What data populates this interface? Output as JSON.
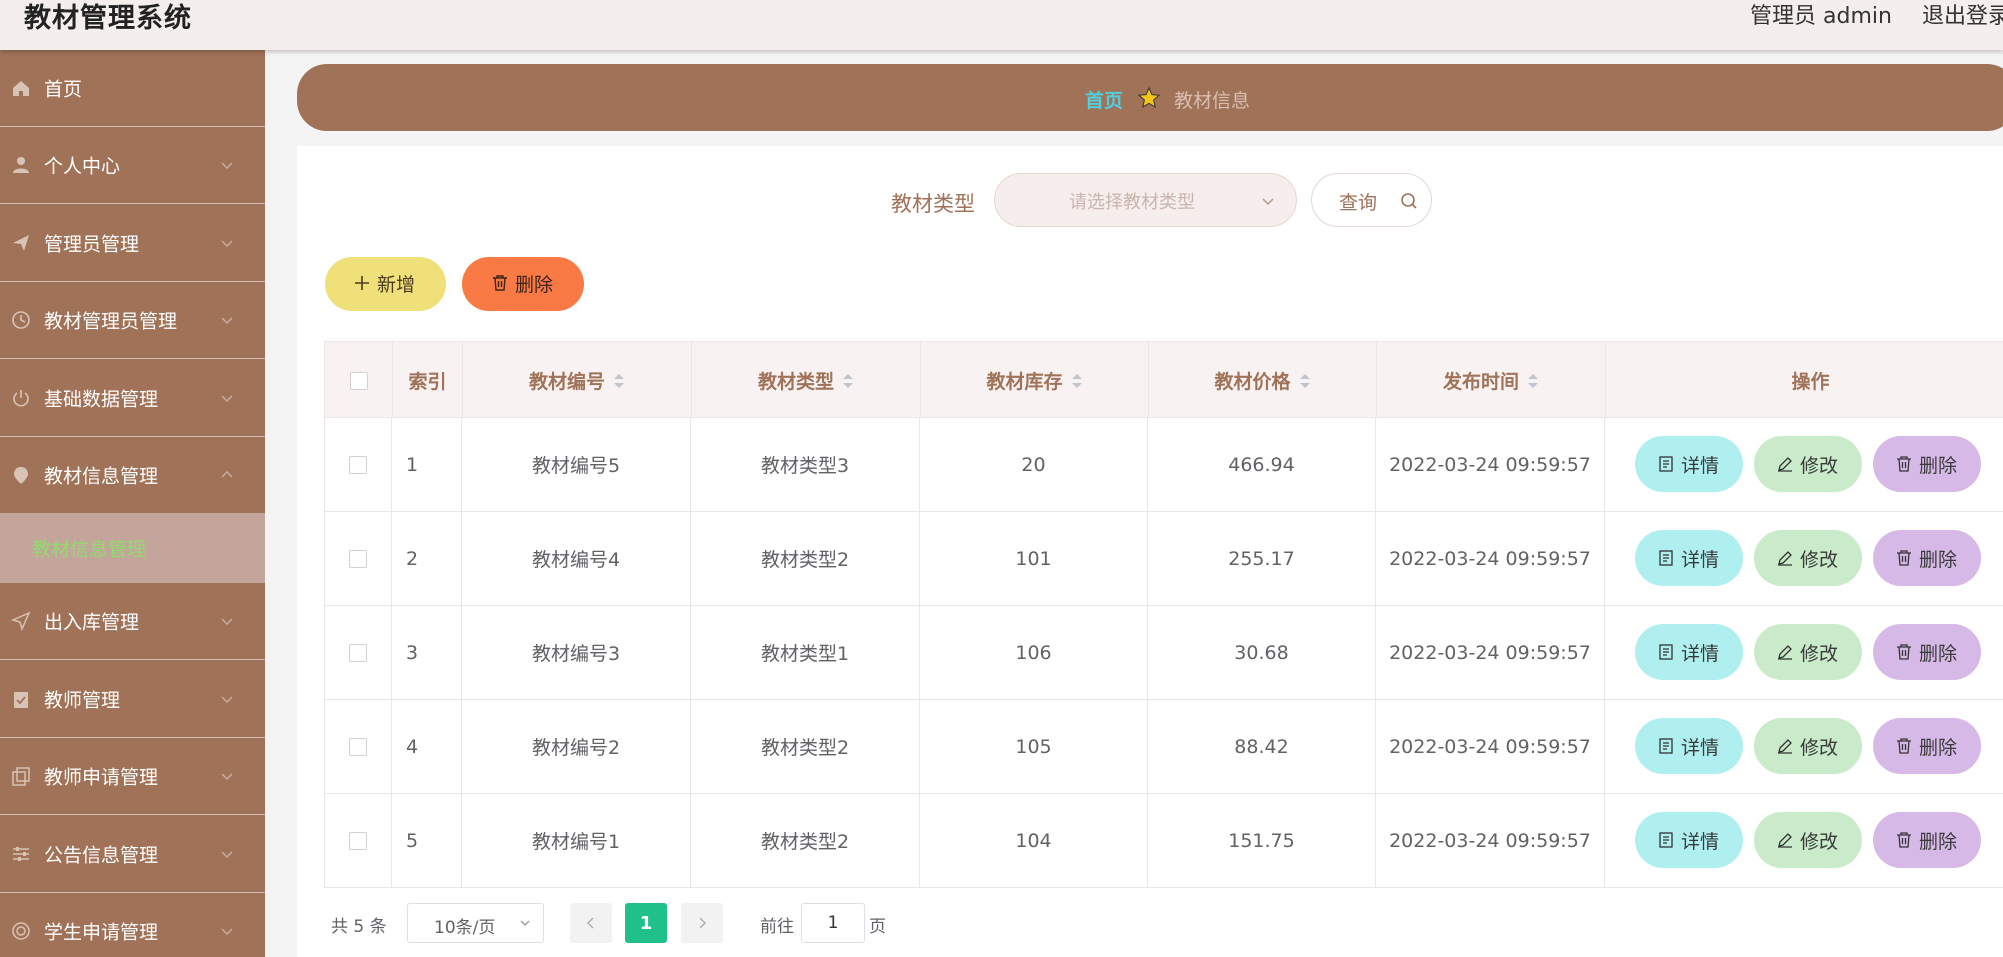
{
  "header": {
    "title": "教材管理系统",
    "user": "管理员 admin",
    "logout": "退出登录"
  },
  "sidebar": {
    "items": [
      {
        "label": "首页",
        "icon": "home-icon"
      },
      {
        "label": "个人中心",
        "icon": "user-icon"
      },
      {
        "label": "管理员管理",
        "icon": "send-icon"
      },
      {
        "label": "教材管理员管理",
        "icon": "clock-icon"
      },
      {
        "label": "基础数据管理",
        "icon": "power-icon"
      },
      {
        "label": "教材信息管理",
        "icon": "location-icon"
      },
      {
        "label": "出入库管理",
        "icon": "navigation-icon"
      },
      {
        "label": "教师管理",
        "icon": "clipboard-icon"
      },
      {
        "label": "教师申请管理",
        "icon": "copy-icon"
      },
      {
        "label": "公告信息管理",
        "icon": "sliders-icon"
      },
      {
        "label": "学生申请管理",
        "icon": "circle-icon"
      }
    ],
    "active_sub": "教材信息管理"
  },
  "breadcrumb": {
    "home": "首页",
    "current": "教材信息"
  },
  "filter": {
    "label": "教材类型",
    "placeholder": "请选择教材类型",
    "query_label": "查询"
  },
  "actions": {
    "add_label": "新增",
    "delete_label": "删除"
  },
  "table": {
    "headers": {
      "index": "索引",
      "code": "教材编号",
      "type": "教材类型",
      "stock": "教材库存",
      "price": "教材价格",
      "time": "发布时间",
      "ops": "操作"
    },
    "rows": [
      {
        "index": "1",
        "code": "教材编号5",
        "type": "教材类型3",
        "stock": "20",
        "price": "466.94",
        "time": "2022-03-24 09:59:57"
      },
      {
        "index": "2",
        "code": "教材编号4",
        "type": "教材类型2",
        "stock": "101",
        "price": "255.17",
        "time": "2022-03-24 09:59:57"
      },
      {
        "index": "3",
        "code": "教材编号3",
        "type": "教材类型1",
        "stock": "106",
        "price": "30.68",
        "time": "2022-03-24 09:59:57"
      },
      {
        "index": "4",
        "code": "教材编号2",
        "type": "教材类型2",
        "stock": "105",
        "price": "88.42",
        "time": "2022-03-24 09:59:57"
      },
      {
        "index": "5",
        "code": "教材编号1",
        "type": "教材类型2",
        "stock": "104",
        "price": "151.75",
        "time": "2022-03-24 09:59:57"
      }
    ],
    "op_labels": {
      "detail": "详情",
      "edit": "修改",
      "delete": "删除"
    }
  },
  "pagination": {
    "total": "共 5 条",
    "page_size": "10条/页",
    "current_page": "1",
    "goto_prefix": "前往",
    "goto_value": "1",
    "goto_suffix": "页"
  },
  "colors": {
    "sidebar": "#a07258",
    "accent": "#20c08a",
    "crumb_home": "#4fd0e0"
  }
}
